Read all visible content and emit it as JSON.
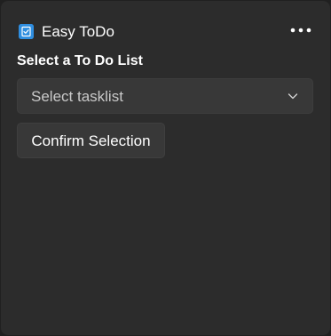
{
  "app": {
    "title": "Easy ToDo",
    "icon": "todo-checkbox-icon",
    "accent": "#2f8ee0",
    "more_icon": "more-horizontal-icon"
  },
  "main": {
    "heading": "Select a To Do List",
    "tasklist_select": {
      "placeholder": "Select tasklist",
      "icon": "chevron-down-icon"
    },
    "confirm_label": "Confirm Selection"
  },
  "colors": {
    "background": "#202020",
    "panel": "#2c2c2c",
    "control": "#383838",
    "text": "#ffffff",
    "muted_text": "#c9c9c9"
  }
}
